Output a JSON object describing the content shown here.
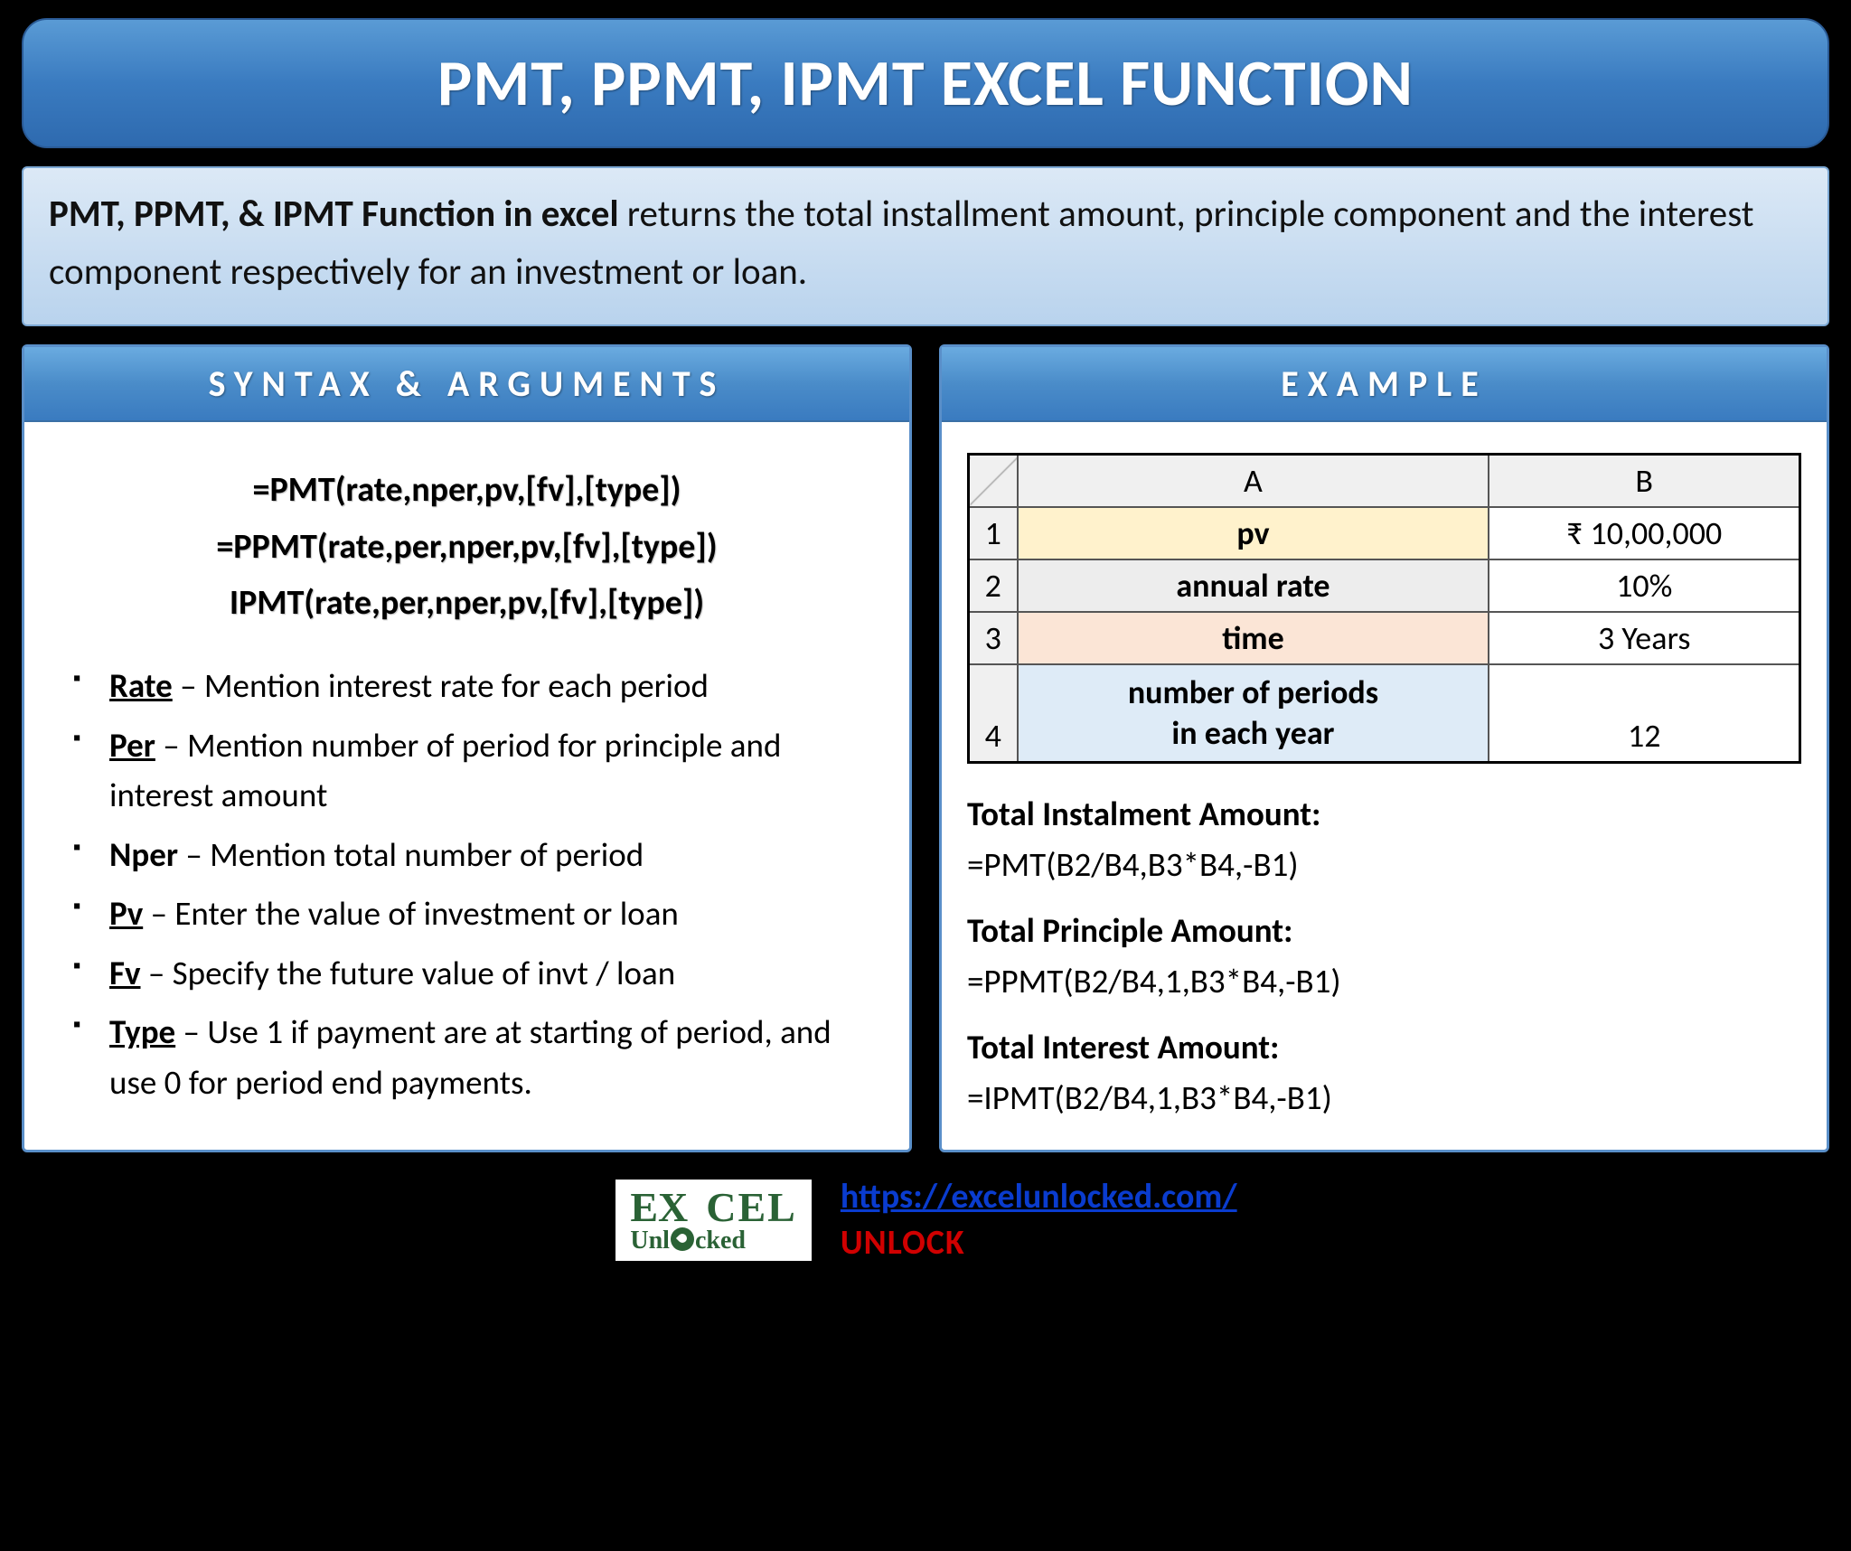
{
  "title": "PMT, PPMT, IPMT EXCEL FUNCTION",
  "description": {
    "bold": "PMT, PPMT, & IPMT Function in excel",
    "rest": " returns the total installment amount, principle component and the interest component respectively for an investment or loan."
  },
  "syntax": {
    "header": "SYNTAX & ARGUMENTS",
    "lines": [
      "=PMT(rate,nper,pv,[fv],[type])",
      "=PPMT(rate,per,nper,pv,[fv],[type])",
      "IPMT(rate,per,nper,pv,[fv],[type])"
    ],
    "args": [
      {
        "name": "Rate",
        "underline": true,
        "desc": " – Mention interest rate for each period"
      },
      {
        "name": "Per",
        "underline": true,
        "desc": " – Mention number of period for principle and interest amount"
      },
      {
        "name": "Nper",
        "underline": false,
        "desc": " – Mention total number of period"
      },
      {
        "name": "Pv",
        "underline": true,
        "desc": " – Enter the value of investment or loan"
      },
      {
        "name": "Fv",
        "underline": true,
        "desc": " – Specify the future value of invt / loan"
      },
      {
        "name": "Type",
        "underline": true,
        "desc": " – Use 1 if payment are at starting of period, and use 0 for period end payments."
      }
    ]
  },
  "example": {
    "header": "EXAMPLE",
    "table": {
      "col_a_header": "A",
      "col_b_header": "B",
      "rows": [
        {
          "n": "1",
          "a": "pv",
          "b": "₹ 10,00,000"
        },
        {
          "n": "2",
          "a": "annual rate",
          "b": "10%"
        },
        {
          "n": "3",
          "a": "time",
          "b": "3 Years"
        },
        {
          "n": "4",
          "a": "number of periods\nin each year",
          "b": "12"
        }
      ]
    },
    "formulas": [
      {
        "title": "Total Instalment Amount:",
        "formula": "=PMT(B2/B4,B3*B4,-B1)"
      },
      {
        "title": "Total Principle Amount:",
        "formula": "=PPMT(B2/B4,1,B3*B4,-B1)"
      },
      {
        "title": "Total Interest Amount:",
        "formula": "=IPMT(B2/B4,1,B3*B4,-B1)"
      }
    ]
  },
  "footer": {
    "logo_top": "EX   CEL",
    "logo_bottom_left": "Unl",
    "logo_bottom_right": "cked",
    "url": "https://excelunlocked.com/",
    "unlock": "UNLOCK"
  }
}
